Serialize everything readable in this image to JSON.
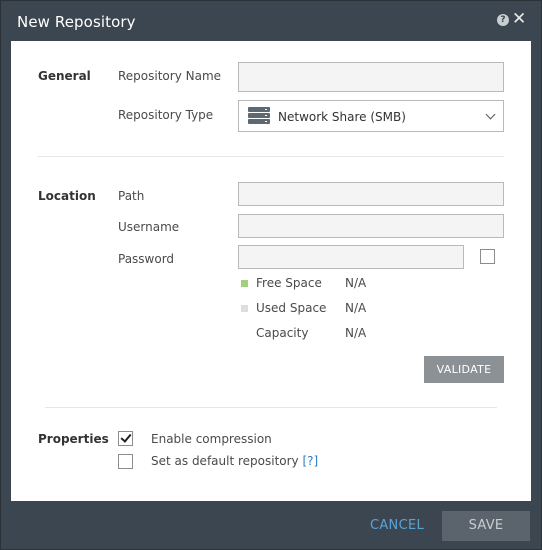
{
  "dialog": {
    "title": "New Repository",
    "help_icon": "?",
    "close_icon": "✕"
  },
  "general": {
    "section_title": "General",
    "repository_name": {
      "label": "Repository Name",
      "value": ""
    },
    "repository_type": {
      "label": "Repository Type",
      "value": "Network Share (SMB)",
      "icon": "server-icon"
    }
  },
  "location": {
    "section_title": "Location",
    "path": {
      "label": "Path",
      "value": ""
    },
    "username": {
      "label": "Username",
      "value": ""
    },
    "password": {
      "label": "Password",
      "value": ""
    },
    "free_space": {
      "label": "Free Space",
      "value": "N/A",
      "color": "#a3d07a"
    },
    "used_space": {
      "label": "Used Space",
      "value": "N/A",
      "color": "#dedede"
    },
    "capacity": {
      "label": "Capacity",
      "value": "N/A"
    },
    "validate_label": "VALIDATE"
  },
  "properties": {
    "section_title": "Properties",
    "enable_compression": {
      "label": "Enable compression",
      "checked": true
    },
    "default_repository": {
      "label": "Set as default repository",
      "help": "[?]",
      "checked": false
    }
  },
  "footer": {
    "cancel_label": "CANCEL",
    "save_label": "SAVE"
  }
}
